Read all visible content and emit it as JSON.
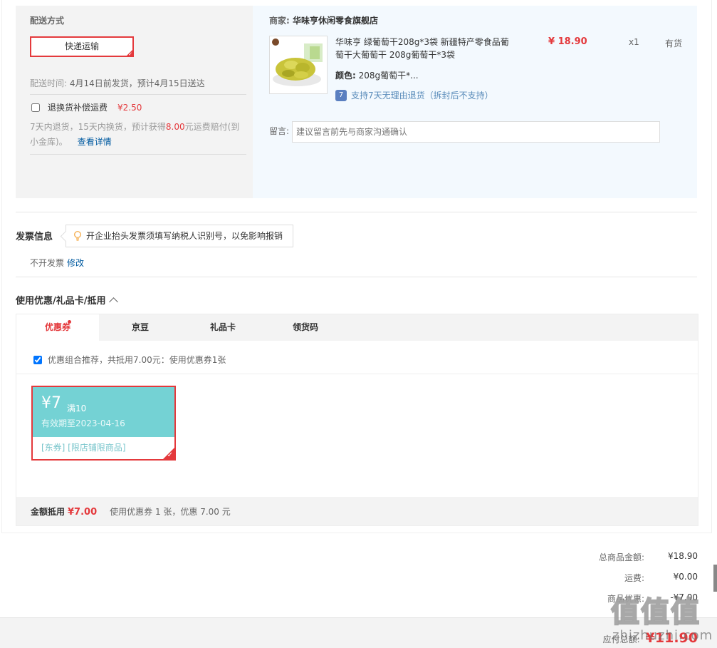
{
  "shipping": {
    "title": "配送方式",
    "method_button": "快递运输",
    "time_label": "配送时间:",
    "time_value": "4月14日前发货，预计4月15日送达",
    "insure_label": "退换货补偿运费",
    "insure_price": "¥2.50",
    "desc_a": "7天内退货，15天内换货，预计获得",
    "desc_amount": "8.00",
    "desc_b": "元运费赔付(到小金库)。",
    "detail_link": "查看详情"
  },
  "goods": {
    "seller_label": "商家:",
    "seller_name": "华味亨休闲零食旗舰店",
    "name": "华味亨 绿葡萄干208g*3袋 新疆特产零食品葡萄干大葡萄干 208g葡萄干*3袋",
    "color_label": "颜色:",
    "color_value": "208g葡萄干*...",
    "return_icon": "return-7day-icon",
    "return_text": "支持7天无理由退货（拆封后不支持）",
    "price": "¥ 18.90",
    "qty": "x1",
    "stock": "有货",
    "message_label": "留言:",
    "message_placeholder": "建议留言前先与商家沟通确认"
  },
  "invoice": {
    "title": "发票信息",
    "tip": "开企业抬头发票须填写纳税人识别号，以免影响报销",
    "value": "不开发票",
    "edit_link": "修改"
  },
  "coupon_section": {
    "title": "使用优惠/礼品卡/抵用",
    "tabs": [
      "优惠券",
      "京豆",
      "礼品卡",
      "领货码"
    ],
    "combo_text": "优惠组合推荐，共抵用7.00元：使用优惠券1张",
    "coupon": {
      "currency": "¥",
      "amount": "7",
      "condition": "满10",
      "expiry": "有效期至2023-04-16",
      "tags": "[东券] [限店铺限商品]",
      "color": "#74d2d4"
    },
    "summary_label": "金额抵用",
    "summary_amount": "¥7.00",
    "summary_note": "使用优惠券 1 张，优惠 7.00 元"
  },
  "totals": {
    "rows": [
      {
        "label": "总商品金额:",
        "value": "¥18.90"
      },
      {
        "label": "运费:",
        "value": "¥0.00"
      },
      {
        "label": "商品优惠:",
        "value": "-¥7.00"
      }
    ],
    "pay_label": "应付总额:",
    "pay_value": "¥11.90"
  },
  "watermark": {
    "glyphs": "值值值",
    "site": "zhizhuzhi.com"
  },
  "colors": {
    "accent": "#e4393c",
    "link": "#005aa0",
    "coupon": "#74d2d4"
  }
}
